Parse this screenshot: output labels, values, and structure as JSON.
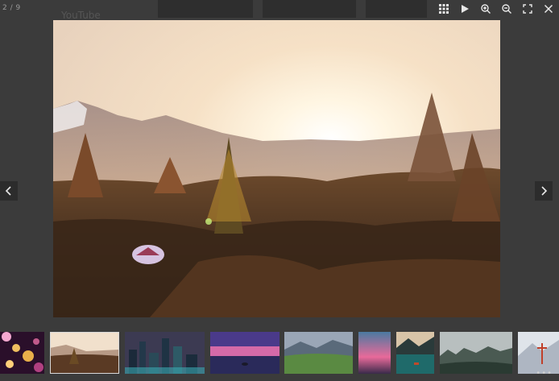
{
  "viewer": {
    "counter": "2 / 9",
    "background_hint": "YouTube",
    "toolbar": [
      {
        "name": "grid-icon"
      },
      {
        "name": "play-icon"
      },
      {
        "name": "zoom-in-icon"
      },
      {
        "name": "zoom-out-icon"
      },
      {
        "name": "fullscreen-icon"
      },
      {
        "name": "close-icon"
      }
    ],
    "current_index": 2,
    "total": 9,
    "main_image": {
      "subject": "mountain-sunset-campsite"
    },
    "thumbnails": [
      {
        "subject": "bokeh-lights",
        "active": false
      },
      {
        "subject": "mountain-sunset-campsite",
        "active": true
      },
      {
        "subject": "city-skyline-night",
        "active": false
      },
      {
        "subject": "purple-sunset-lake",
        "active": false
      },
      {
        "subject": "green-valley-mountains",
        "active": false
      },
      {
        "subject": "pink-sky-horizon",
        "active": false
      },
      {
        "subject": "mountain-lake-boat",
        "active": false
      },
      {
        "subject": "foggy-forest-hills",
        "active": false
      },
      {
        "subject": "snowy-mountain-figure",
        "active": false
      }
    ],
    "colors": {
      "overlay": "#3b3b3b",
      "icon": "#e8e8e8",
      "active_border": "#d8d8d8"
    }
  }
}
